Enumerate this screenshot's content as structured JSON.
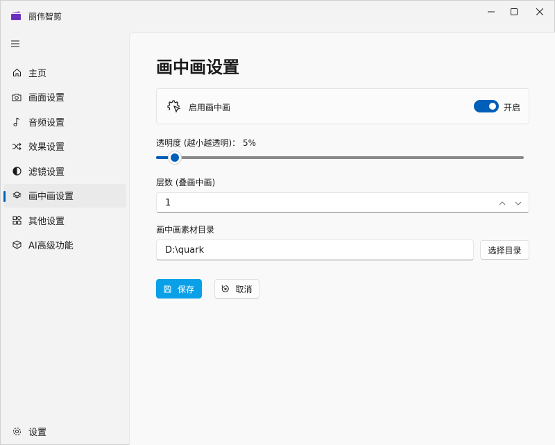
{
  "app": {
    "title": "丽伟智剪",
    "accent": "#005fb8",
    "save_color": "#0aa0e8"
  },
  "window_controls": [
    "minimize-icon",
    "maximize-icon",
    "close-icon"
  ],
  "sidebar": {
    "items": [
      {
        "label": "主页",
        "icon": "home-icon"
      },
      {
        "label": "画面设置",
        "icon": "camera-icon"
      },
      {
        "label": "音频设置",
        "icon": "music-note-icon"
      },
      {
        "label": "效果设置",
        "icon": "shuffle-icon"
      },
      {
        "label": "滤镜设置",
        "icon": "contrast-icon"
      },
      {
        "label": "画中画设置",
        "icon": "layers-icon",
        "active": true
      },
      {
        "label": "其他设置",
        "icon": "apps-icon"
      },
      {
        "label": "AI高级功能",
        "icon": "cube-icon"
      }
    ],
    "settings_label": "设置"
  },
  "main": {
    "page_title": "画中画设置",
    "pip_card": {
      "label": "启用画中画",
      "toggle_on": true,
      "toggle_text": "开启"
    },
    "opacity": {
      "label": "透明度 (越小越透明)：",
      "value_text": "5%",
      "value": 5,
      "min": 0,
      "max": 100
    },
    "layers": {
      "label": "层数 (叠画中画)",
      "value": "1"
    },
    "material_dir": {
      "label": "画中画素材目录",
      "value": "D:\\quark",
      "button_label": "选择目录"
    },
    "save_label": "保存",
    "cancel_label": "取消"
  }
}
